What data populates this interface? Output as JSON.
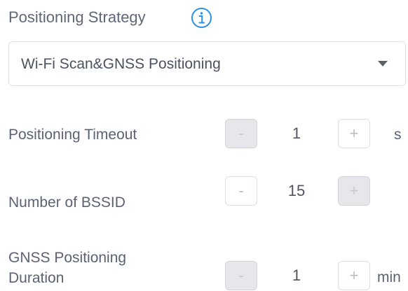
{
  "positioning_strategy": {
    "title": "Positioning Strategy",
    "info_icon": "info-circle-icon",
    "selected": "Wi-Fi Scan&GNSS Positioning",
    "dropdown_icon": "caret-down-icon"
  },
  "colors": {
    "accent": "#2f8fe0",
    "label": "#5a6273",
    "disabled_button": "#e6e7ea",
    "border": "#dcdfe5"
  },
  "rows": {
    "timeout": {
      "label": "Positioning Timeout",
      "minus": "-",
      "value": "1",
      "plus": "+",
      "unit": "s",
      "minus_disabled": true,
      "plus_disabled": false
    },
    "bssid": {
      "label": "Number of BSSID",
      "minus": "-",
      "value": "15",
      "plus": "+",
      "minus_disabled": false,
      "plus_disabled": true
    },
    "gnss": {
      "label_line1": "GNSS Positioning",
      "label_line2": "Duration",
      "minus": "-",
      "value": "1",
      "plus": "+",
      "unit": "min",
      "minus_disabled": true,
      "plus_disabled": false
    }
  }
}
